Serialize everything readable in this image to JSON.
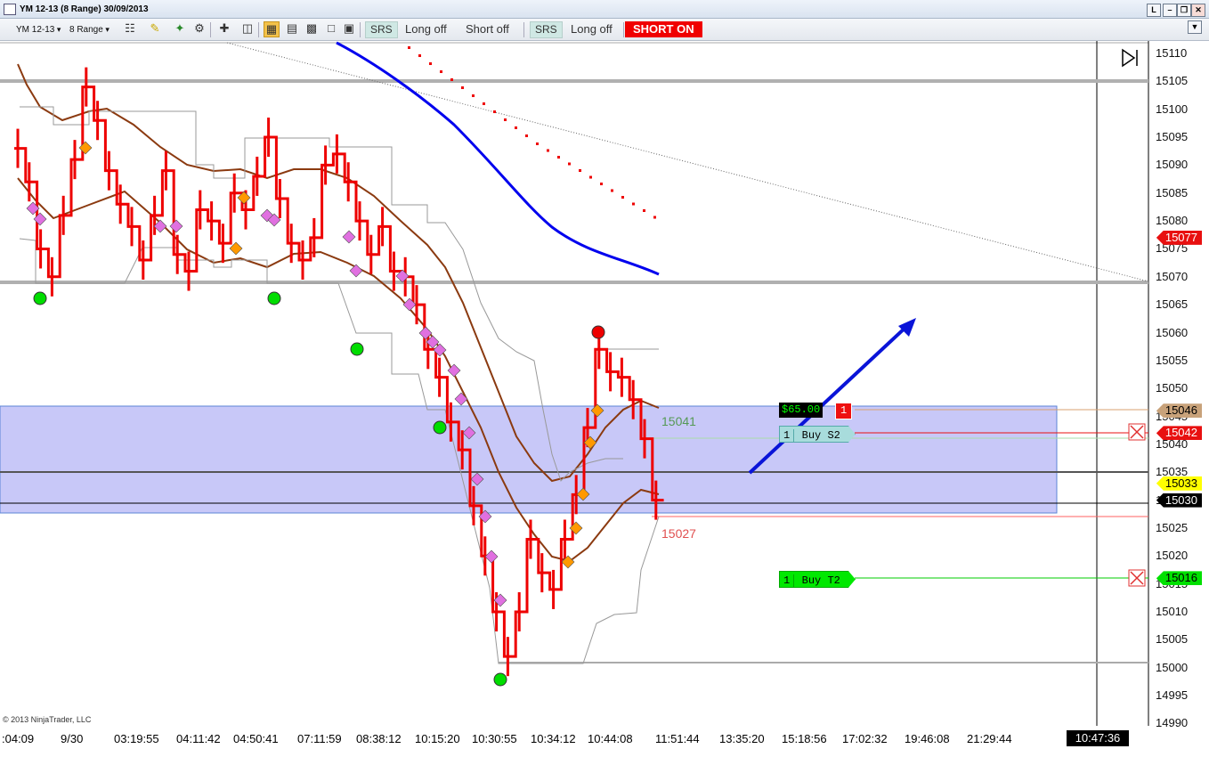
{
  "window": {
    "title": "YM 12-13 (8 Range)  30/09/2013"
  },
  "toolbar": {
    "instrument": "YM 12-13",
    "period": "8 Range",
    "srs1": "SRS",
    "long_off_1": "Long off",
    "short_off": "Short off",
    "srs2": "SRS",
    "long_off_2": "Long off",
    "short_on": "SHORT ON"
  },
  "price_axis": {
    "ticks": [
      "15110",
      "15105",
      "15100",
      "15095",
      "15090",
      "15085",
      "15080",
      "15075",
      "15070",
      "15065",
      "15060",
      "15055",
      "15050",
      "15045",
      "15040",
      "15035",
      "15030",
      "15025",
      "15020",
      "15015",
      "15010",
      "15005",
      "15000",
      "14995",
      "14990"
    ],
    "markers": [
      {
        "price": "15077",
        "bg": "#e81010",
        "fg": "#ffffff"
      },
      {
        "price": "15046",
        "bg": "#c8a27a",
        "fg": "#000000"
      },
      {
        "price": "15042",
        "bg": "#e81010",
        "fg": "#ffffff"
      },
      {
        "price": "15033",
        "bg": "#ffff00",
        "fg": "#000000"
      },
      {
        "price": "15030",
        "bg": "#000000",
        "fg": "#ffffff"
      },
      {
        "price": "15016",
        "bg": "#00e000",
        "fg": "#000000"
      }
    ]
  },
  "time_axis": {
    "labels": [
      ":04:09",
      "9/30",
      "03:19:55",
      "04:11:42",
      "04:50:41",
      "07:11:59",
      "08:38:12",
      "10:15:20",
      "10:30:55",
      "10:34:12",
      "10:44:08",
      "11:51:44",
      "13:35:20",
      "15:18:56",
      "17:02:32",
      "19:46:08",
      "21:29:44"
    ],
    "current_time": "10:47:36"
  },
  "annotations": {
    "level_upper": "15041",
    "level_lower": "15027",
    "copyright": "© 2013 NinjaTrader, LLC"
  },
  "orders": {
    "pnl": "$65.00",
    "position_qty": "1",
    "stop": {
      "qty": "1",
      "label": "Buy S2"
    },
    "target": {
      "qty": "1",
      "label": "Buy T2"
    }
  },
  "colors": {
    "bars": "#ee0000",
    "band": "#c8c8f8",
    "ma_blue": "#0000ee",
    "envelope": "#8b3a10",
    "swing_low": "#00dd00",
    "swing_high": "#ee0000",
    "diamond_pink": "#e070e0",
    "diamond_orange": "#ff9900"
  },
  "chart_data": {
    "type": "line",
    "title": "YM 12-13 (8 Range)",
    "ylim": [
      14990,
      15112
    ],
    "series": [
      {
        "values": [
          15093,
          15087,
          15075,
          15070,
          15081,
          15091,
          15104,
          15098,
          15089,
          15083,
          15079,
          15073,
          15081,
          15089,
          15074,
          15071,
          15082,
          15080,
          15076,
          15085,
          15082,
          15088,
          15095,
          15084,
          15076,
          15073,
          15077,
          15090,
          15092,
          15087,
          15080,
          15074,
          15079,
          15071,
          15070,
          15065,
          15057,
          15052,
          15044,
          15039,
          15029,
          15020,
          15010,
          15002,
          15010,
          15023,
          15017,
          15014,
          15023,
          15031,
          15043,
          15057,
          15053,
          15052,
          15048,
          15041,
          15030
        ]
      }
    ],
    "levels": [
      15105,
      15069,
      15041,
      15033,
      15030,
      15027,
      15001
    ],
    "band": [
      15028,
      15047
    ]
  }
}
